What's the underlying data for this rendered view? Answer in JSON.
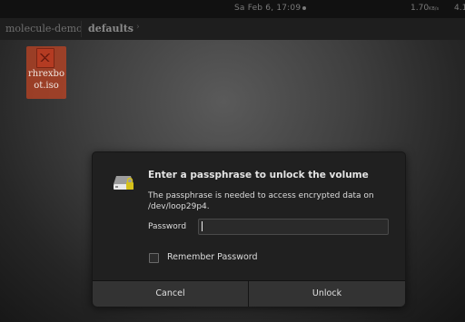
{
  "topbar": {
    "clock": "Sa Feb  6, 17:09",
    "network_rate": "1.70",
    "network_unit": "KB/s",
    "battery": "4.1"
  },
  "tabs": [
    {
      "label": "molecule-demo"
    },
    {
      "label": "defaults"
    }
  ],
  "desktop": {
    "file_icon_label": "rhrexboot.iso",
    "file_icon_line1": "rhrexbo",
    "file_icon_line2": "ot.iso"
  },
  "dialog": {
    "title": "Enter a passphrase to unlock the volume",
    "description": "The passphrase is needed to access encrypted data on /dev/loop29p4.",
    "password_label": "Password",
    "password_value": "",
    "remember_label": "Remember Password",
    "remember_checked": false,
    "cancel_label": "Cancel",
    "unlock_label": "Unlock"
  },
  "icons": {
    "drive": "drive-lock-icon",
    "file": "iso-file-icon",
    "tab_arrow": "chevron-right-icon"
  },
  "colors": {
    "desktop_center": "#5a5a5a",
    "dialog_bg": "#202020",
    "button_bg": "#333333",
    "icon_selection": "#c44422",
    "lock_yellow": "#d6c11a"
  }
}
